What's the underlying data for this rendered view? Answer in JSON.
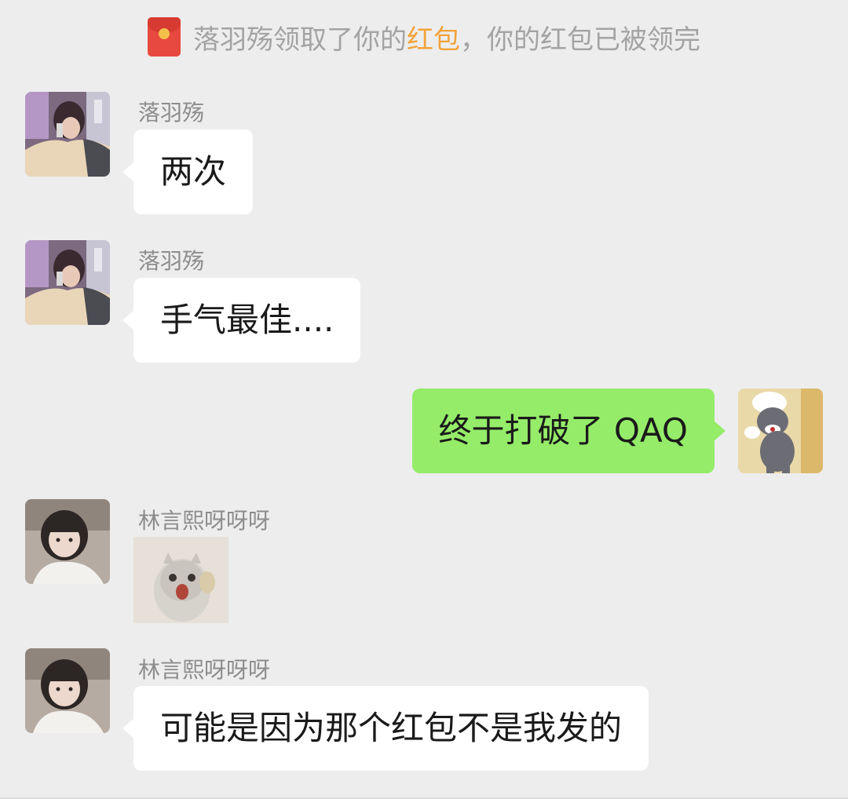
{
  "system_notice": {
    "prefix": "落羽殇领取了你的",
    "link": "红包",
    "suffix": "，你的红包已被领完",
    "icon": "red-packet-icon"
  },
  "messages": [
    {
      "sender": "落羽殇",
      "text": "两次",
      "side": "left",
      "avatar": "girl-holding-phone-avatar"
    },
    {
      "sender": "落羽殇",
      "text": "手气最佳....",
      "side": "left",
      "avatar": "girl-holding-phone-avatar"
    },
    {
      "sender": "",
      "text": "终于打破了 QAQ",
      "side": "right",
      "avatar": "cartoon-cat-chef-avatar"
    },
    {
      "sender": "林言熙呀呀呀",
      "text": "",
      "side": "left",
      "avatar": "girl-portrait-avatar",
      "sticker": "surprised-cat-sticker"
    },
    {
      "sender": "林言熙呀呀呀",
      "text": "可能是因为那个红包不是我发的",
      "side": "left",
      "avatar": "girl-portrait-avatar"
    }
  ],
  "colors": {
    "background": "#ededed",
    "incoming_bubble": "#ffffff",
    "outgoing_bubble": "#95ec69",
    "red_packet_link": "#f2a33a",
    "system_text": "#a3a3a3"
  }
}
